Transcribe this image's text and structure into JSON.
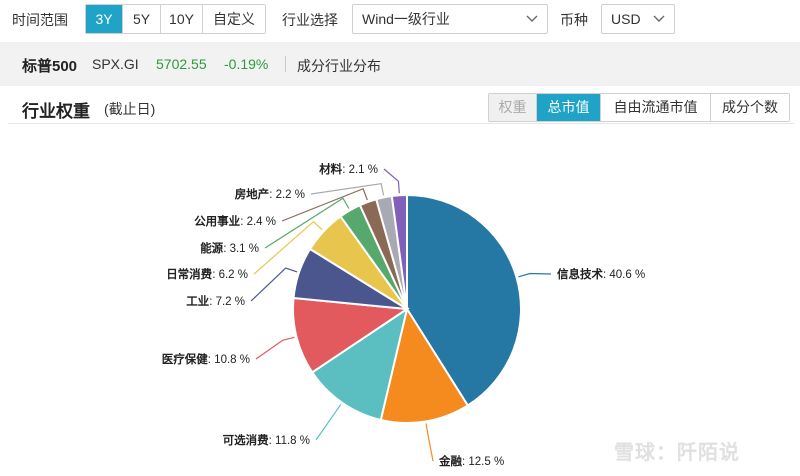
{
  "controls": {
    "time_range_label": "时间范围",
    "time_options": [
      "3Y",
      "5Y",
      "10Y",
      "自定义"
    ],
    "time_selected": "3Y",
    "industry_label": "行业选择",
    "industry_value": "Wind一级行业",
    "currency_label": "币种",
    "currency_value": "USD"
  },
  "index": {
    "name": "标普500",
    "code": "SPX.GI",
    "price": "5702.55",
    "change": "-0.19%",
    "subtitle": "成分行业分布"
  },
  "card": {
    "title": "行业权重",
    "title_note": "(截止日)",
    "tabs": [
      "权重",
      "总市值",
      "自由流通市值",
      "成分个数"
    ],
    "active_tab": "总市值",
    "disabled_tab": "权重"
  },
  "colors": {
    "accent": "#1fa4c8",
    "positive_green": "#2e9a3c"
  },
  "watermark": "雪球：阡陌说",
  "chart_data": {
    "type": "pie",
    "unit": "%",
    "slices": [
      {
        "name": "信息技术",
        "value": 40.6,
        "color": "#2478a3"
      },
      {
        "name": "金融",
        "value": 12.5,
        "color": "#f58a1e"
      },
      {
        "name": "可选消费",
        "value": 11.8,
        "color": "#5bbfc2"
      },
      {
        "name": "医疗保健",
        "value": 10.8,
        "color": "#e25a5e"
      },
      {
        "name": "工业",
        "value": 7.2,
        "color": "#4b568f"
      },
      {
        "name": "日常消费",
        "value": 6.2,
        "color": "#e8c64e"
      },
      {
        "name": "能源",
        "value": 3.1,
        "color": "#56a86d"
      },
      {
        "name": "公用事业",
        "value": 2.4,
        "color": "#8a6a55"
      },
      {
        "name": "房地产",
        "value": 2.2,
        "color": "#a9a9b3"
      },
      {
        "name": "材料",
        "value": 2.1,
        "color": "#8060b8"
      }
    ]
  }
}
